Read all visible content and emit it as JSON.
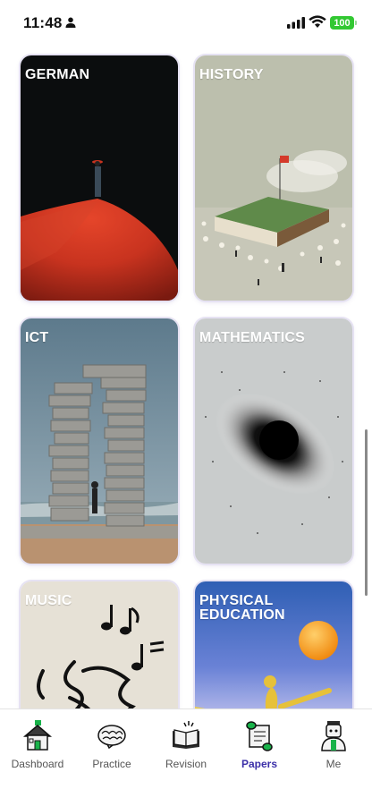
{
  "status_bar": {
    "time": "11:48",
    "battery": "100"
  },
  "subjects": [
    {
      "title": "GERMAN"
    },
    {
      "title": "HISTORY"
    },
    {
      "title": "ICT"
    },
    {
      "title": "MATHEMATICS"
    },
    {
      "title": "MUSIC"
    },
    {
      "title": "PHYSICAL EDUCATION"
    }
  ],
  "tabs": [
    {
      "label": "Dashboard",
      "icon": "house-icon"
    },
    {
      "label": "Practice",
      "icon": "brain-icon"
    },
    {
      "label": "Revision",
      "icon": "open-book-icon"
    },
    {
      "label": "Papers",
      "icon": "scroll-icon",
      "active": true
    },
    {
      "label": "Me",
      "icon": "avatar-icon"
    }
  ],
  "colors": {
    "accent": "#3b2fa8",
    "battery": "#32c832"
  }
}
